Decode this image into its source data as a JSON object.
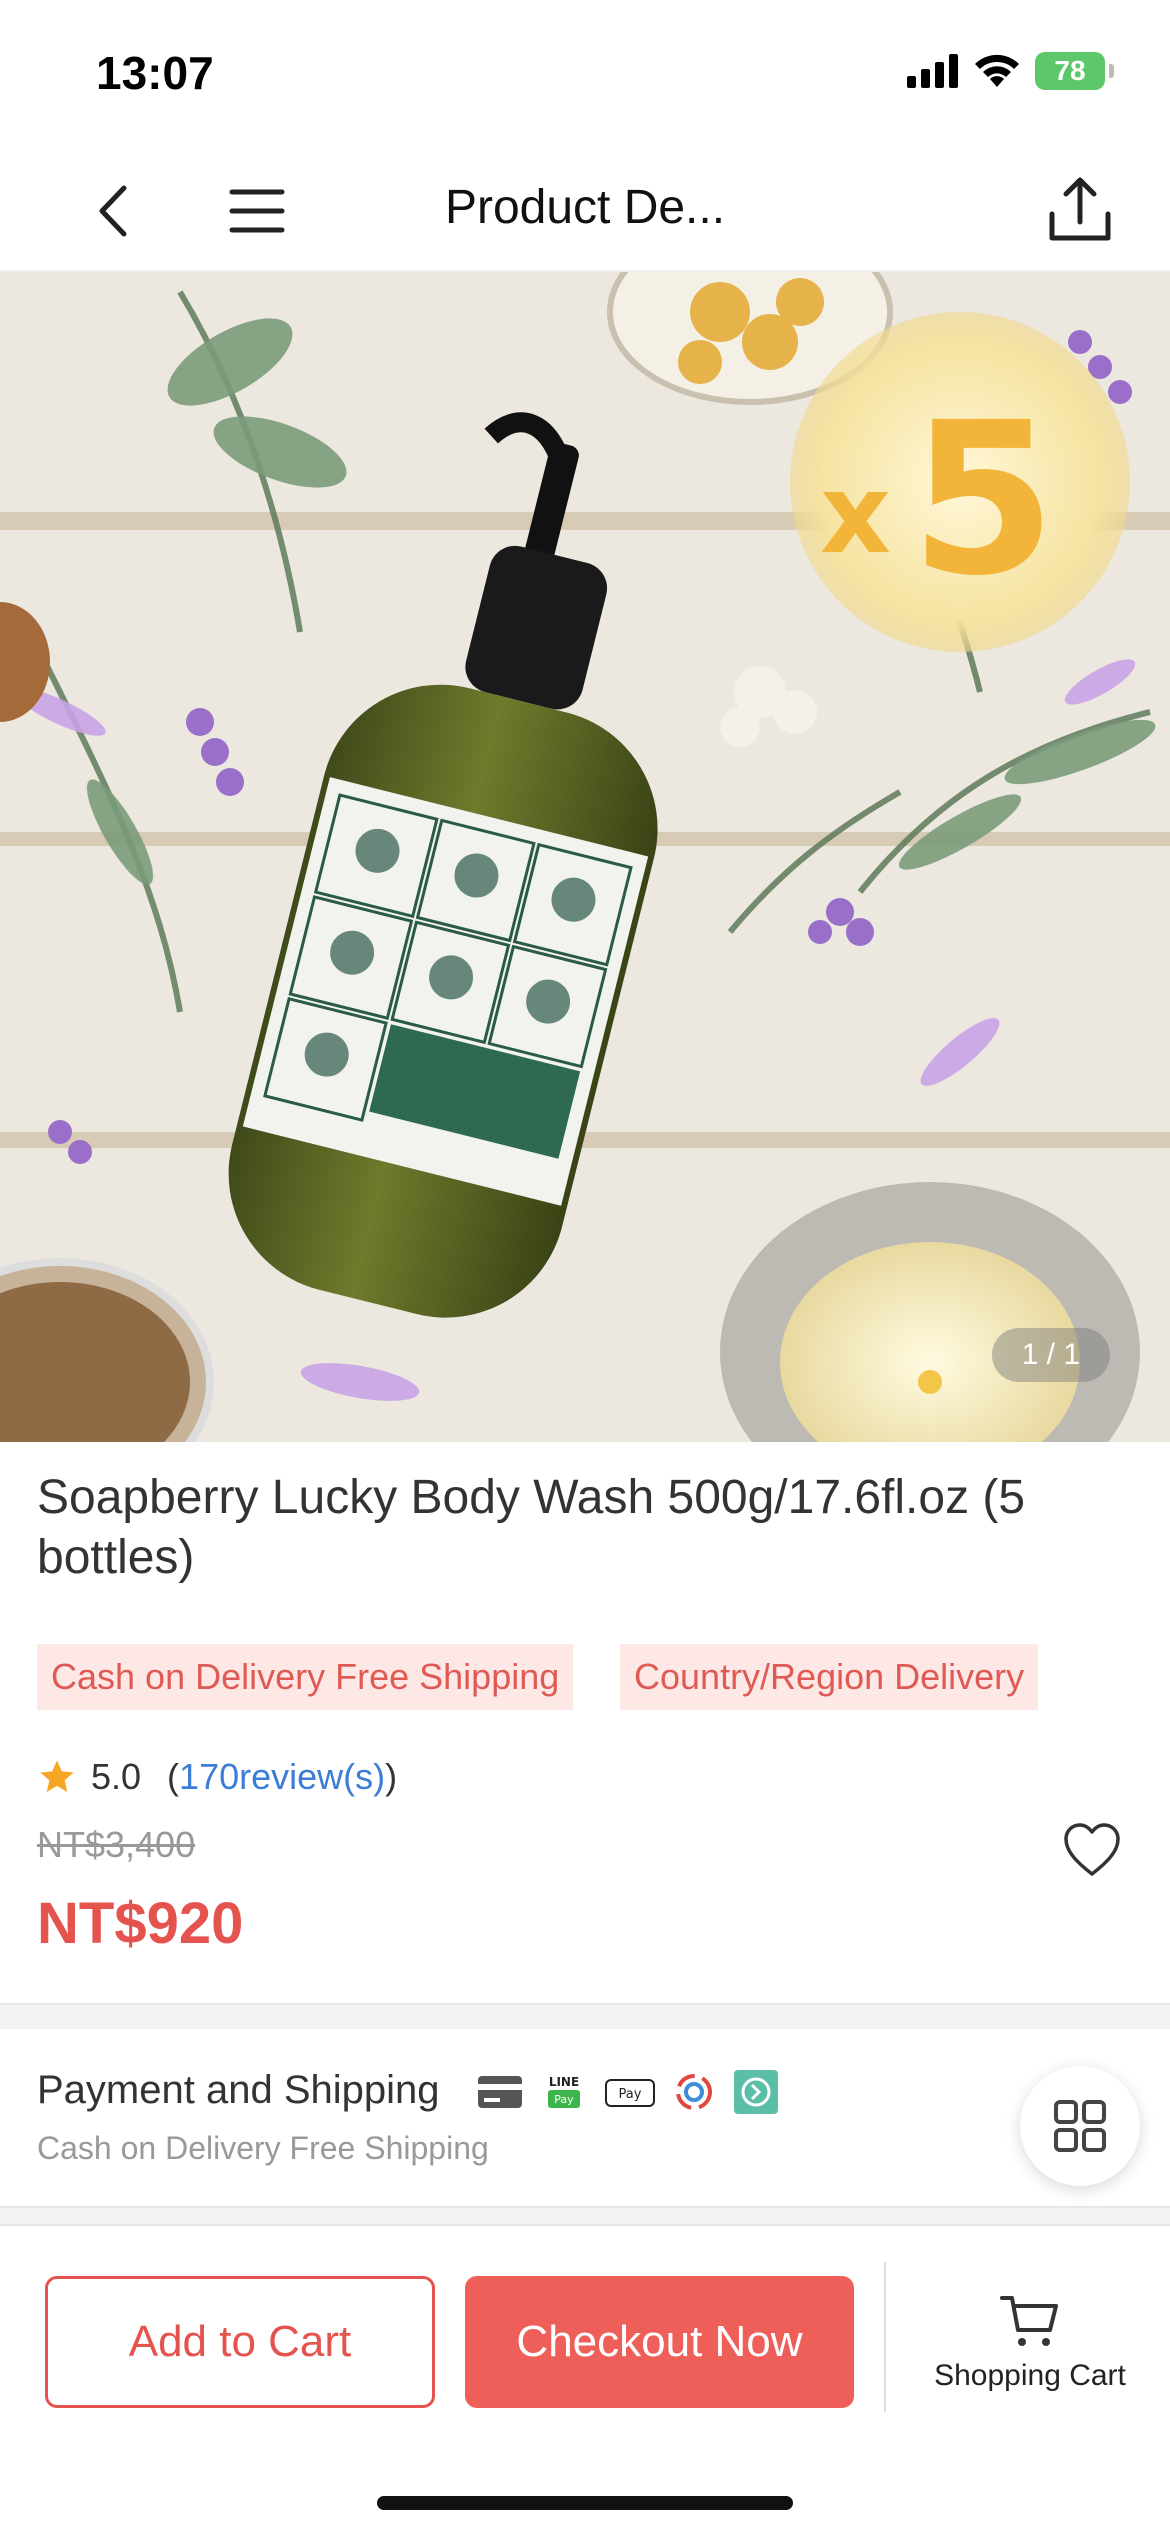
{
  "status_bar": {
    "time": "13:07",
    "battery": "78"
  },
  "nav": {
    "title": "Product De..."
  },
  "gallery": {
    "badge_text": "x5",
    "counter": "1 / 1"
  },
  "product": {
    "title": "Soapberry Lucky Body Wash 500g/17.6fl.oz (5 bottles)",
    "tags": [
      "Cash on Delivery Free Shipping",
      "Country/Region Delivery"
    ],
    "rating": "5.0",
    "reviews_open": "(",
    "reviews_link": "170review(s)",
    "reviews_close": ")",
    "original_price": "NT$3,400",
    "price": "NT$920"
  },
  "payment": {
    "title": "Payment and Shipping",
    "subtitle": "Cash on Delivery Free Shipping",
    "icons": [
      "credit-card-icon",
      "line-pay-icon",
      "apple-pay-icon",
      "jkopay-icon",
      "pay-arrow-icon"
    ]
  },
  "bottom_bar": {
    "add_to_cart": "Add to Cart",
    "checkout": "Checkout Now",
    "cart_label": "Shopping Cart"
  },
  "colors": {
    "accent": "#e5534f",
    "tag_bg": "#fde8e6",
    "link": "#3d7dd6",
    "badge": "#f2b53a"
  }
}
